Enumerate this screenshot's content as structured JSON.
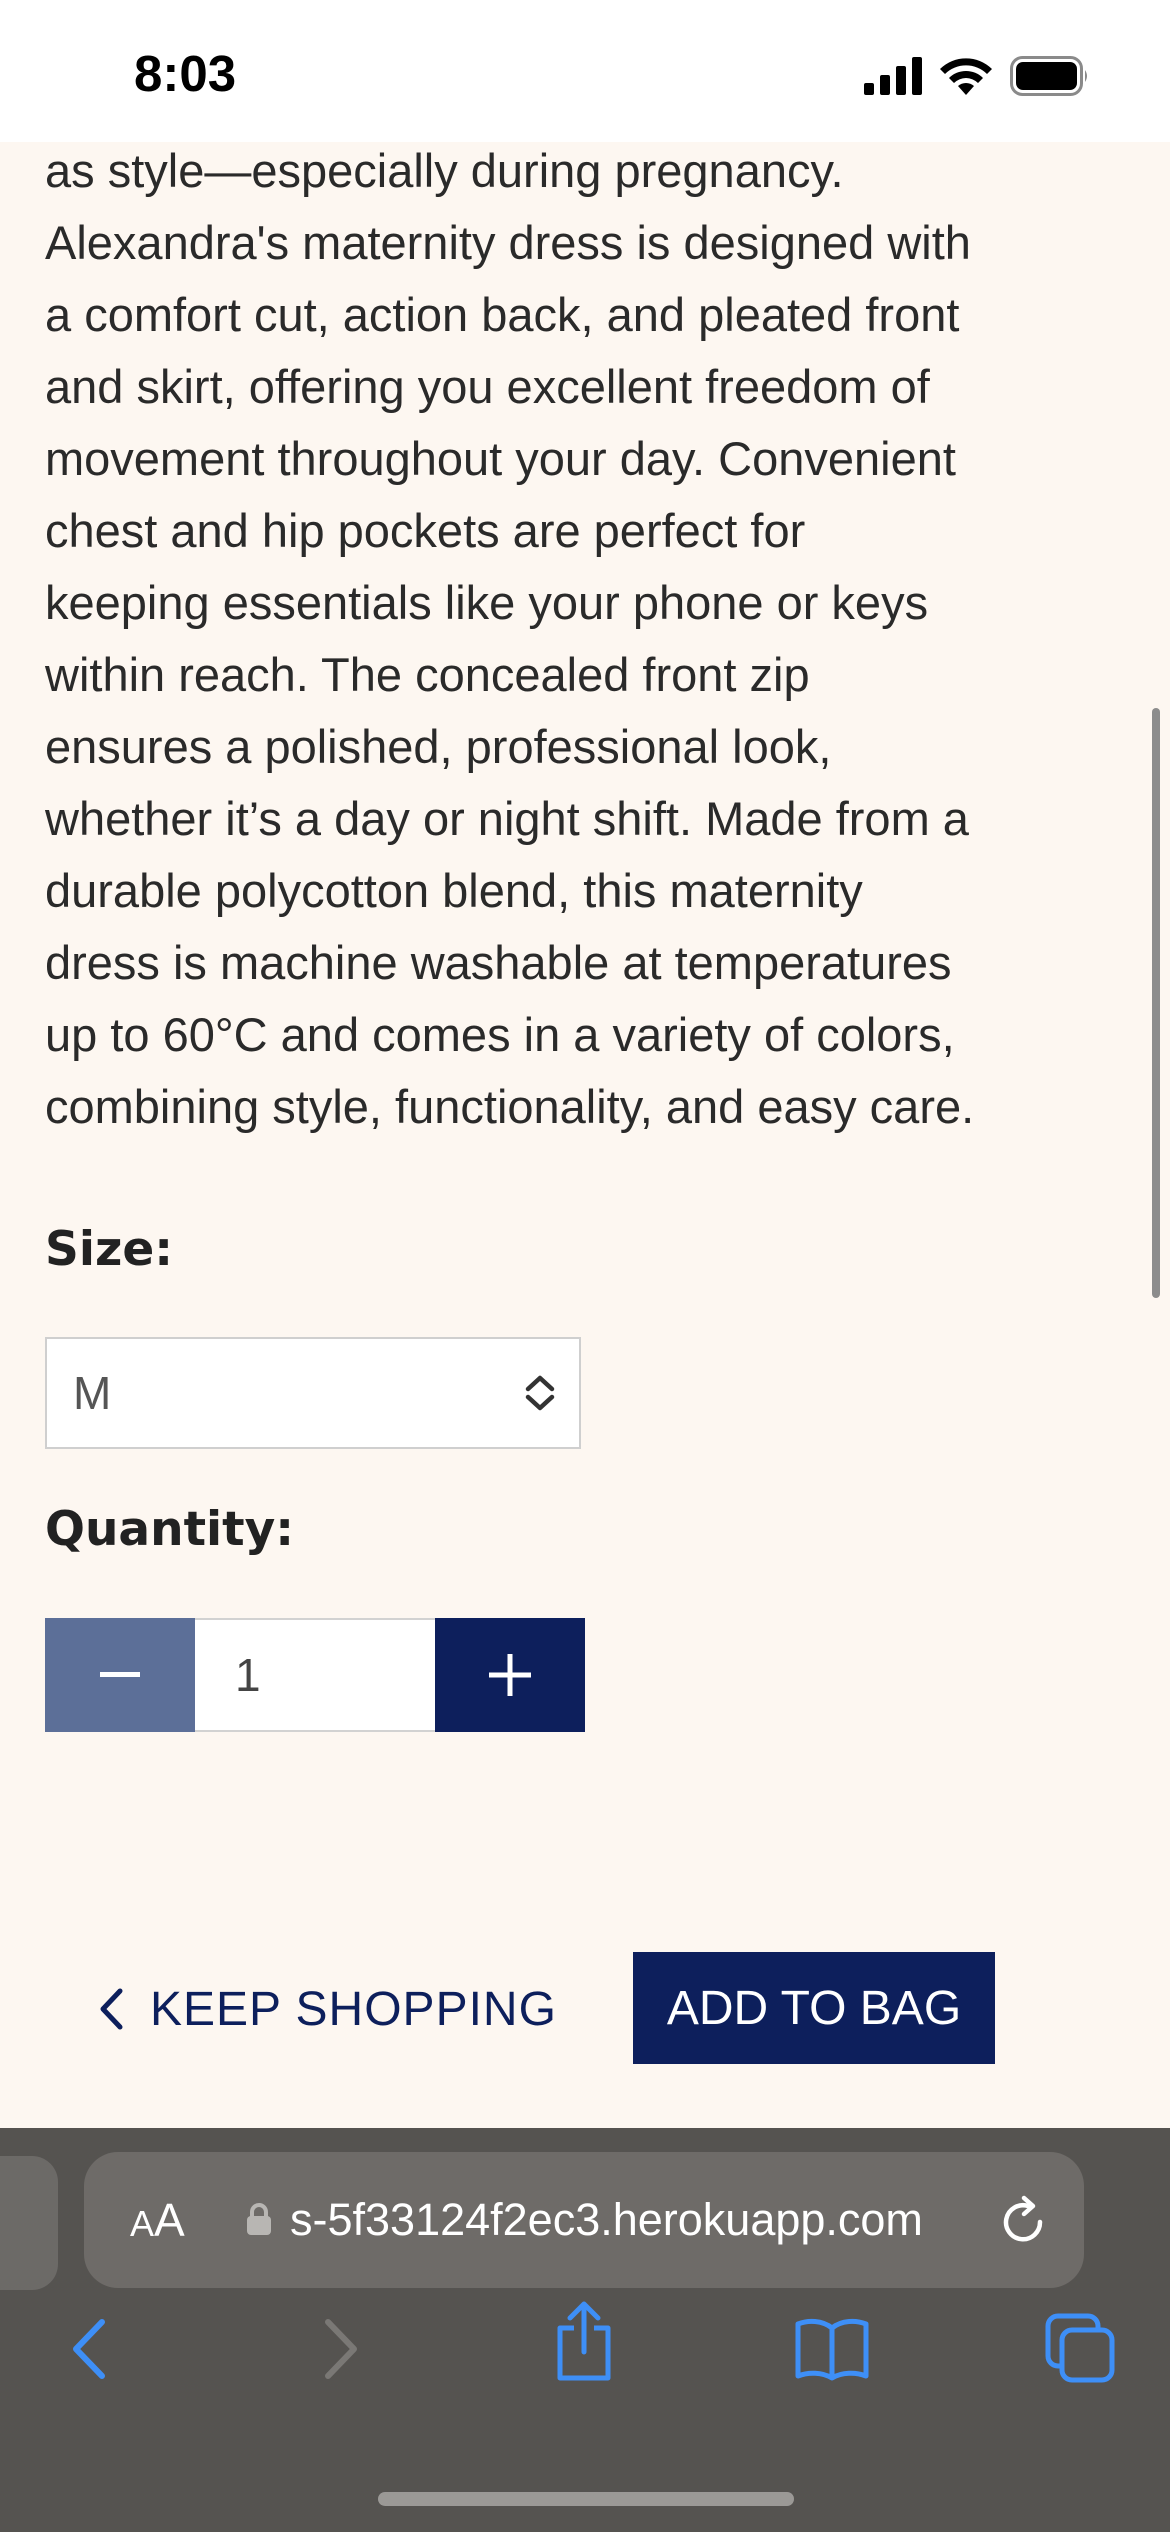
{
  "status_bar": {
    "time": "8:03"
  },
  "description": {
    "lines": [
      "as style—especially during pregnancy.",
      "Alexandra's maternity dress is designed with",
      "a comfort cut, action back, and pleated front",
      "and skirt, offering you excellent freedom of",
      "movement throughout your day. Convenient",
      "chest and hip pockets are perfect for",
      "keeping essentials like your phone or keys",
      "within reach. The concealed front zip",
      "ensures a polished, professional look,",
      "whether it’s a day or night shift. Made from a",
      "durable polycotton blend, this maternity",
      "dress is machine washable at temperatures",
      "up to 60°C and comes in a variety of colors,",
      "combining style, functionality, and easy care."
    ]
  },
  "size": {
    "label": "Size:",
    "selected": "M"
  },
  "quantity": {
    "label": "Quantity:",
    "value": "1"
  },
  "actions": {
    "keep_shopping": "KEEP SHOPPING",
    "add_to_bag": "ADD TO BAG"
  },
  "browser": {
    "aa_small": "A",
    "aa_big": "A",
    "url": "s-5f33124f2ec3.herokuapp.com"
  },
  "colors": {
    "page_bg": "#fdf7f1",
    "navy": "#0d1f5c",
    "minus_button": "#5c6f98",
    "browser_chrome": "#555350",
    "toolbar_icon": "#3e8ff7"
  },
  "icons": {
    "signal": "cellular-signal-icon",
    "wifi": "wifi-icon",
    "battery": "battery-icon",
    "select": "up-down-chevron-icon",
    "minus": "minus-icon",
    "plus": "plus-icon",
    "back": "chevron-left-icon",
    "lock": "lock-icon",
    "reload": "reload-icon",
    "share": "share-icon",
    "bookmarks": "book-icon",
    "tabs": "tabs-icon"
  }
}
